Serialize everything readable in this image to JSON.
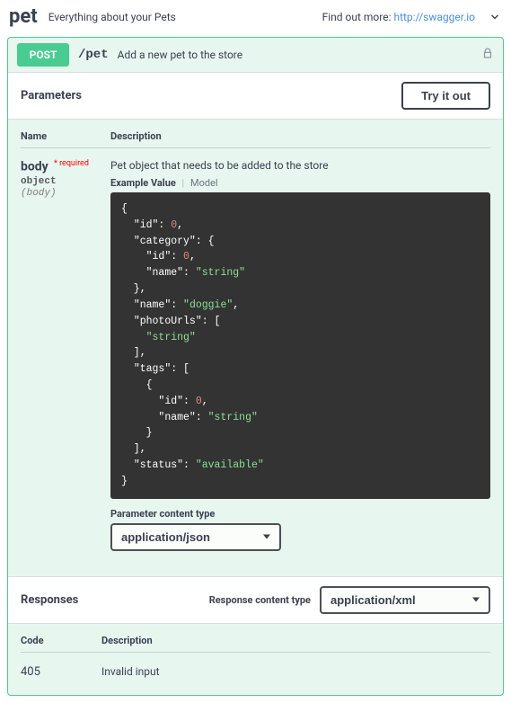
{
  "tag": {
    "name": "pet",
    "description": "Everything about your Pets",
    "find_more": "Find out more:",
    "find_more_url": "http://swagger.io"
  },
  "operation": {
    "method": "POST",
    "path": "/pet",
    "summary": "Add a new pet to the store"
  },
  "labels": {
    "parameters": "Parameters",
    "try_it_out": "Try it out",
    "name_header": "Name",
    "description_header": "Description",
    "example_value": "Example Value",
    "model": "Model",
    "param_content_type": "Parameter content type",
    "responses": "Responses",
    "response_content_type": "Response content type",
    "code_header": "Code",
    "required": "required"
  },
  "parameter": {
    "name": "body",
    "required_marker": "*",
    "type": "object",
    "in": "(body)",
    "description": "Pet object that needs to be added to the store",
    "content_type_selected": "application/json"
  },
  "example_tokens": [
    {
      "t": "p",
      "v": "{"
    },
    {
      "t": "p",
      "v": "  "
    },
    {
      "t": "k",
      "v": "\"id\""
    },
    {
      "t": "p",
      "v": ": "
    },
    {
      "t": "n",
      "v": "0"
    },
    {
      "t": "p",
      "v": ","
    },
    {
      "t": "nl"
    },
    {
      "t": "p",
      "v": "  "
    },
    {
      "t": "k",
      "v": "\"category\""
    },
    {
      "t": "p",
      "v": ": {"
    },
    {
      "t": "nl"
    },
    {
      "t": "p",
      "v": "    "
    },
    {
      "t": "k",
      "v": "\"id\""
    },
    {
      "t": "p",
      "v": ": "
    },
    {
      "t": "n",
      "v": "0"
    },
    {
      "t": "p",
      "v": ","
    },
    {
      "t": "nl"
    },
    {
      "t": "p",
      "v": "    "
    },
    {
      "t": "k",
      "v": "\"name\""
    },
    {
      "t": "p",
      "v": ": "
    },
    {
      "t": "s",
      "v": "\"string\""
    },
    {
      "t": "nl"
    },
    {
      "t": "p",
      "v": "  },"
    },
    {
      "t": "nl"
    },
    {
      "t": "p",
      "v": "  "
    },
    {
      "t": "k",
      "v": "\"name\""
    },
    {
      "t": "p",
      "v": ": "
    },
    {
      "t": "s",
      "v": "\"doggie\""
    },
    {
      "t": "p",
      "v": ","
    },
    {
      "t": "nl"
    },
    {
      "t": "p",
      "v": "  "
    },
    {
      "t": "k",
      "v": "\"photoUrls\""
    },
    {
      "t": "p",
      "v": ": ["
    },
    {
      "t": "nl"
    },
    {
      "t": "p",
      "v": "    "
    },
    {
      "t": "s",
      "v": "\"string\""
    },
    {
      "t": "nl"
    },
    {
      "t": "p",
      "v": "  ],"
    },
    {
      "t": "nl"
    },
    {
      "t": "p",
      "v": "  "
    },
    {
      "t": "k",
      "v": "\"tags\""
    },
    {
      "t": "p",
      "v": ": ["
    },
    {
      "t": "nl"
    },
    {
      "t": "p",
      "v": "    {"
    },
    {
      "t": "nl"
    },
    {
      "t": "p",
      "v": "      "
    },
    {
      "t": "k",
      "v": "\"id\""
    },
    {
      "t": "p",
      "v": ": "
    },
    {
      "t": "n",
      "v": "0"
    },
    {
      "t": "p",
      "v": ","
    },
    {
      "t": "nl"
    },
    {
      "t": "p",
      "v": "      "
    },
    {
      "t": "k",
      "v": "\"name\""
    },
    {
      "t": "p",
      "v": ": "
    },
    {
      "t": "s",
      "v": "\"string\""
    },
    {
      "t": "nl"
    },
    {
      "t": "p",
      "v": "    }"
    },
    {
      "t": "nl"
    },
    {
      "t": "p",
      "v": "  ],"
    },
    {
      "t": "nl"
    },
    {
      "t": "p",
      "v": "  "
    },
    {
      "t": "k",
      "v": "\"status\""
    },
    {
      "t": "p",
      "v": ": "
    },
    {
      "t": "s",
      "v": "\"available\""
    },
    {
      "t": "nl"
    },
    {
      "t": "p",
      "v": "}"
    }
  ],
  "responses": {
    "content_type_selected": "application/xml",
    "rows": [
      {
        "code": "405",
        "description": "Invalid input"
      }
    ]
  }
}
